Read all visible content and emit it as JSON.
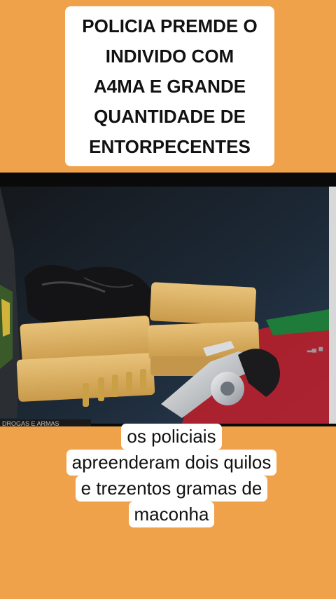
{
  "headline": {
    "lines": [
      "POLICIA  PREMDE O",
      "INDIVIDO COM",
      "A4MA E GRANDE",
      "QUANTIDADE DE",
      "ENTORPECENTES"
    ]
  },
  "photo": {
    "lower_text": "DROGAS E ARMAS",
    "description_icon": "seized-drugs-and-revolver-photo"
  },
  "caption": {
    "lines": [
      "os policiais",
      "apreenderam dois quilos",
      "e trezentos gramas de",
      "maconha"
    ]
  },
  "colors": {
    "background": "#F0A24B",
    "panel": "#FFFFFF",
    "text": "#111111"
  }
}
